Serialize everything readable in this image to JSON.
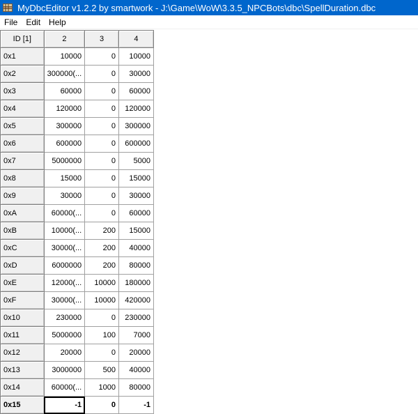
{
  "window": {
    "title": "MyDbcEditor v1.2.2 by smartwork - J:\\Game\\WoW\\3.3.5_NPCBots\\dbc\\SpellDuration.dbc",
    "titlebar_color": "#0066cc",
    "icon": "app-icon"
  },
  "menu": {
    "items": [
      "File",
      "Edit",
      "Help"
    ]
  },
  "grid": {
    "columns": [
      "ID [1]",
      "2",
      "3",
      "4"
    ],
    "rows": [
      {
        "id": "0x1",
        "c2": "10000",
        "c3": "0",
        "c4": "10000"
      },
      {
        "id": "0x2",
        "c2": "300000(...",
        "c3": "0",
        "c4": "30000"
      },
      {
        "id": "0x3",
        "c2": "60000",
        "c3": "0",
        "c4": "60000"
      },
      {
        "id": "0x4",
        "c2": "120000",
        "c3": "0",
        "c4": "120000"
      },
      {
        "id": "0x5",
        "c2": "300000",
        "c3": "0",
        "c4": "300000"
      },
      {
        "id": "0x6",
        "c2": "600000",
        "c3": "0",
        "c4": "600000"
      },
      {
        "id": "0x7",
        "c2": "5000000",
        "c3": "0",
        "c4": "5000"
      },
      {
        "id": "0x8",
        "c2": "15000",
        "c3": "0",
        "c4": "15000"
      },
      {
        "id": "0x9",
        "c2": "30000",
        "c3": "0",
        "c4": "30000"
      },
      {
        "id": "0xA",
        "c2": "60000(...",
        "c3": "0",
        "c4": "60000"
      },
      {
        "id": "0xB",
        "c2": "10000(...",
        "c3": "200",
        "c4": "15000"
      },
      {
        "id": "0xC",
        "c2": "30000(...",
        "c3": "200",
        "c4": "40000"
      },
      {
        "id": "0xD",
        "c2": "6000000",
        "c3": "200",
        "c4": "80000"
      },
      {
        "id": "0xE",
        "c2": "12000(...",
        "c3": "10000",
        "c4": "180000"
      },
      {
        "id": "0xF",
        "c2": "30000(...",
        "c3": "10000",
        "c4": "420000"
      },
      {
        "id": "0x10",
        "c2": "230000",
        "c3": "0",
        "c4": "230000"
      },
      {
        "id": "0x11",
        "c2": "5000000",
        "c3": "100",
        "c4": "7000"
      },
      {
        "id": "0x12",
        "c2": "20000",
        "c3": "0",
        "c4": "20000"
      },
      {
        "id": "0x13",
        "c2": "3000000",
        "c3": "500",
        "c4": "40000"
      },
      {
        "id": "0x14",
        "c2": "60000(...",
        "c3": "1000",
        "c4": "80000"
      },
      {
        "id": "0x15",
        "c2": "-1",
        "c3": "0",
        "c4": "-1"
      }
    ],
    "selected_row": "0x15"
  }
}
